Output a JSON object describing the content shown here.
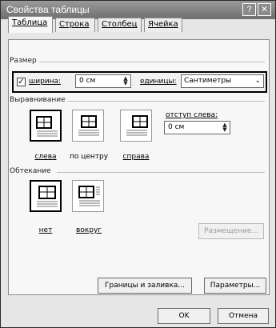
{
  "window": {
    "title": "Свойства таблицы",
    "help_label": "?",
    "close_label": "✕"
  },
  "tabs": [
    {
      "label": "Таблица",
      "active": true
    },
    {
      "label": "Строка",
      "active": false
    },
    {
      "label": "Столбец",
      "active": false
    },
    {
      "label": "Ячейка",
      "active": false
    }
  ],
  "size": {
    "section_label": "Размер",
    "width_checkbox_checked": true,
    "width_label": "ширина:",
    "width_value": "0 см",
    "units_label": "единицы:",
    "units_value": "Сантиметры"
  },
  "alignment": {
    "section_label": "Выравнивание",
    "options": [
      {
        "label": "слева",
        "selected": true
      },
      {
        "label": "по центру",
        "selected": false
      },
      {
        "label": "справа",
        "selected": false
      }
    ],
    "indent_label": "отступ слева:",
    "indent_value": "0 см"
  },
  "wrapping": {
    "section_label": "Обтекание",
    "options": [
      {
        "label": "нет",
        "selected": true
      },
      {
        "label": "вокруг",
        "selected": false
      }
    ],
    "positioning_button": "Размещение..."
  },
  "buttons": {
    "borders_shading": "Границы и заливка...",
    "options": "Параметры...",
    "ok": "OK",
    "cancel": "Отмена"
  },
  "icons": {
    "checkbox": "check-mark-glyph",
    "spin": "spin-arrows",
    "dropdown": "chevron-down"
  }
}
